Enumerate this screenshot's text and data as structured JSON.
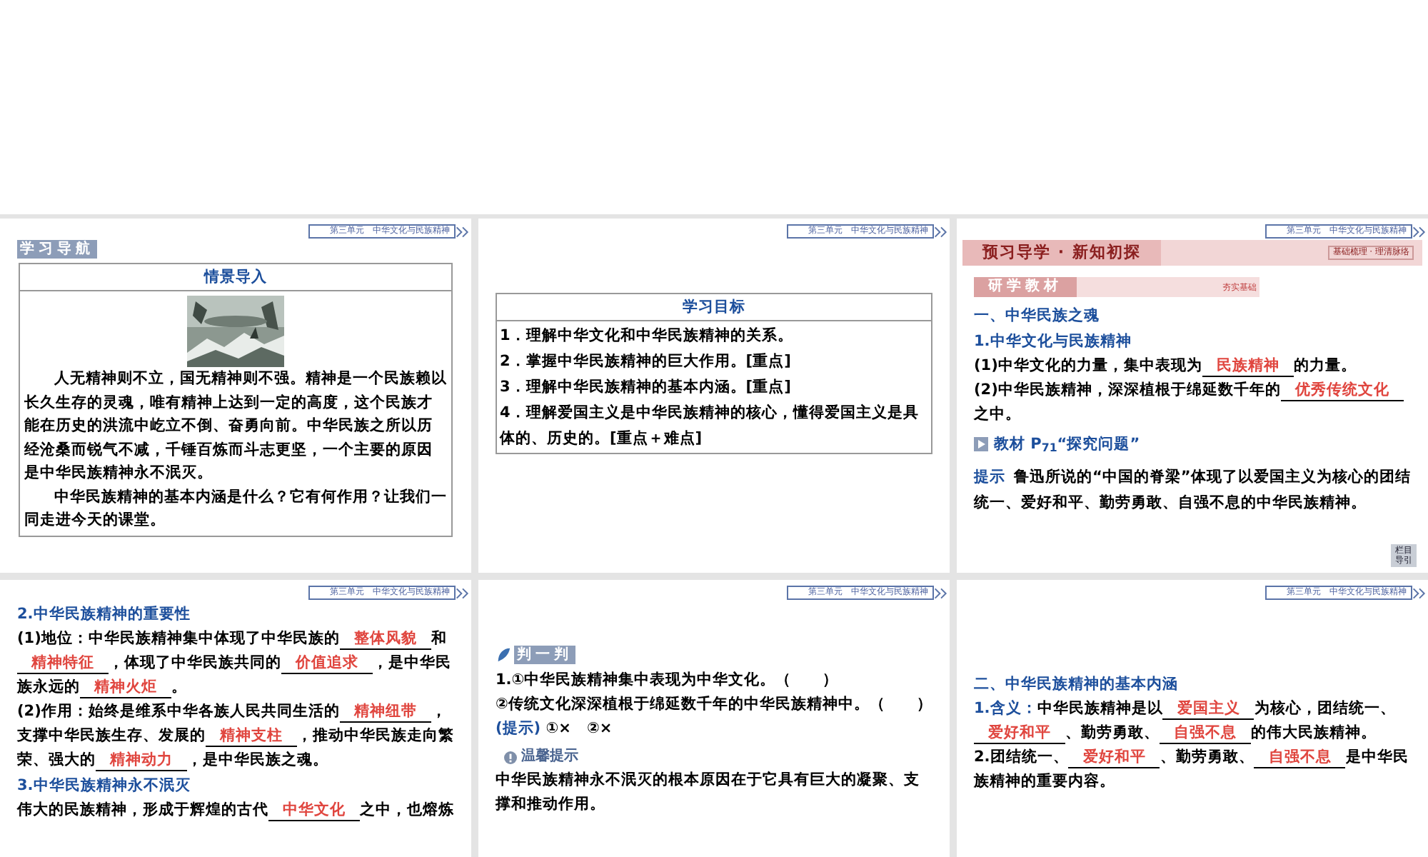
{
  "slides": [
    {
      "header": "第三单元　中华文化与民族精神",
      "blocks": [
        {
          "kind": "badge",
          "text": "学习导航"
        },
        {
          "kind": "scene",
          "title": "情景导入",
          "paragraphs": [
            "人无精神则不立，国无精神则不强。精神是一个民族赖以长久生存的灵魂，唯有精神上达到一定的高度，这个民族才能在历史的洪流中屹立不倒、奋勇向前。中华民族之所以历经沧桑而锐气不减，千锤百炼而斗志更坚，一个主要的原因是中华民族精神永不泯灭。",
            "中华民族精神的基本内涵是什么？它有何作用？让我们一同走进今天的课堂。"
          ]
        }
      ]
    },
    {
      "header": "第三单元　中华文化与民族精神",
      "blocks": [
        {
          "kind": "goals",
          "title": "学习目标",
          "items": [
            "1．理解中华文化和中华民族精神的关系。",
            "2．掌握中华民族精神的巨大作用。[重点]",
            "3．理解中华民族精神的基本内涵。[重点]",
            "4．理解爱国主义是中华民族精神的核心，懂得爱国主义是具体的、历史的。[重点＋难点]"
          ]
        }
      ]
    },
    {
      "header": "第三单元　中华文化与民族精神",
      "nav": "栏目导引",
      "blocks": [
        {
          "kind": "banner",
          "text": "预习导学 · 新知初探",
          "side": "基础梳理 · 理清脉络"
        },
        {
          "kind": "subbanner",
          "text": "研学教材",
          "side": "夯实基础"
        },
        {
          "kind": "heading",
          "text": "一、中华民族之魂"
        },
        {
          "kind": "heading",
          "text": "1.中华文化与民族精神"
        },
        {
          "kind": "para",
          "parts": [
            {
              "kind": "text",
              "text": "(1)中华文化的力量，集中表现为"
            },
            {
              "kind": "blank",
              "text": "民族精神"
            },
            {
              "kind": "text",
              "text": "的力量。"
            }
          ]
        },
        {
          "kind": "para",
          "parts": [
            {
              "kind": "text",
              "text": "(2)中华民族精神，深深植根于绵延数千年的"
            },
            {
              "kind": "blank",
              "text": "优秀传统文化"
            },
            {
              "kind": "text",
              "text": "之中。"
            }
          ]
        },
        {
          "kind": "source",
          "text": "教材 P$_{71}$“探究问题”"
        },
        {
          "kind": "tip",
          "label": "提示",
          "text": "鲁迅所说的“中国的脊梁”体现了以爱国主义为核心的团结统一、爱好和平、勤劳勇敢、自强不息的中华民族精神。"
        }
      ]
    },
    {
      "header": "第三单元　中华文化与民族精神",
      "blocks": [
        {
          "kind": "heading",
          "text": "2.中华民族精神的重要性"
        },
        {
          "kind": "para",
          "parts": [
            {
              "kind": "text",
              "text": "(1)地位：中华民族精神集中体现了中华民族的"
            },
            {
              "kind": "blank",
              "text": "整体风貌"
            },
            {
              "kind": "text",
              "text": "和"
            },
            {
              "kind": "blank",
              "text": "精神特征"
            },
            {
              "kind": "text",
              "text": "，体现了中华民族共同的"
            },
            {
              "kind": "blank",
              "text": "价值追求"
            },
            {
              "kind": "text",
              "text": "，是中华民族永远的"
            },
            {
              "kind": "blank",
              "text": "精神火炬"
            },
            {
              "kind": "text",
              "text": "。"
            }
          ]
        },
        {
          "kind": "para",
          "parts": [
            {
              "kind": "text",
              "text": "(2)作用：始终是维系中华各族人民共同生活的"
            },
            {
              "kind": "blank",
              "text": "精神纽带"
            },
            {
              "kind": "text",
              "text": "，支撑中华民族生存、发展的"
            },
            {
              "kind": "blank",
              "text": "精神支柱"
            },
            {
              "kind": "text",
              "text": "，推动中华民族走向繁荣、强大的"
            },
            {
              "kind": "blank",
              "text": "精神动力"
            },
            {
              "kind": "text",
              "text": "，是中华民族之魂。"
            }
          ]
        },
        {
          "kind": "heading",
          "text": "3.中华民族精神永不泯灭"
        },
        {
          "kind": "para",
          "parts": [
            {
              "kind": "text",
              "text": "伟大的民族精神，形成于辉煌的古代"
            },
            {
              "kind": "blank",
              "text": "中华文化"
            },
            {
              "kind": "text",
              "text": "之中，也熔炼"
            }
          ]
        }
      ]
    },
    {
      "header": "第三单元　中华文化与民族精神",
      "blocks": [
        {
          "kind": "judge_badge",
          "text": "判一判"
        },
        {
          "kind": "para",
          "parts": [
            {
              "kind": "text",
              "text": "1.①中华民族精神集中表现为中华文化。（　　）"
            }
          ]
        },
        {
          "kind": "para",
          "parts": [
            {
              "kind": "text",
              "text": "②传统文化深深植根于绵延数千年的中华民族精神中。（　　）"
            }
          ]
        },
        {
          "kind": "para",
          "parts": [
            {
              "kind": "label",
              "text": "(提示)"
            },
            {
              "kind": "text",
              "text": " ①×　②×"
            }
          ]
        },
        {
          "kind": "notice",
          "text": "温馨提示"
        },
        {
          "kind": "para",
          "parts": [
            {
              "kind": "text",
              "text": "中华民族精神永不泯灭的根本原因在于它具有巨大的凝聚、支撑和推动作用。"
            }
          ]
        }
      ]
    },
    {
      "header": "第三单元　中华文化与民族精神",
      "blocks": [
        {
          "kind": "heading",
          "text": "二、中华民族精神的基本内涵"
        },
        {
          "kind": "para",
          "parts": [
            {
              "kind": "label",
              "text": "1.含义："
            },
            {
              "kind": "text",
              "text": "中华民族精神是以"
            },
            {
              "kind": "blank",
              "text": "爱国主义"
            },
            {
              "kind": "text",
              "text": "为核心，团结统一、"
            },
            {
              "kind": "blank",
              "text": "爱好和平"
            },
            {
              "kind": "text",
              "text": "、勤劳勇敢、"
            },
            {
              "kind": "blank",
              "text": "自强不息"
            },
            {
              "kind": "text",
              "text": "的伟大民族精神。"
            }
          ]
        },
        {
          "kind": "para",
          "parts": [
            {
              "kind": "text",
              "text": "2.团结统一、"
            },
            {
              "kind": "blank",
              "text": "爱好和平"
            },
            {
              "kind": "text",
              "text": "、勤劳勇敢、"
            },
            {
              "kind": "blank",
              "text": "自强不息"
            },
            {
              "kind": "text",
              "text": "是中华民族精神的重要内容。"
            }
          ]
        }
      ]
    }
  ]
}
